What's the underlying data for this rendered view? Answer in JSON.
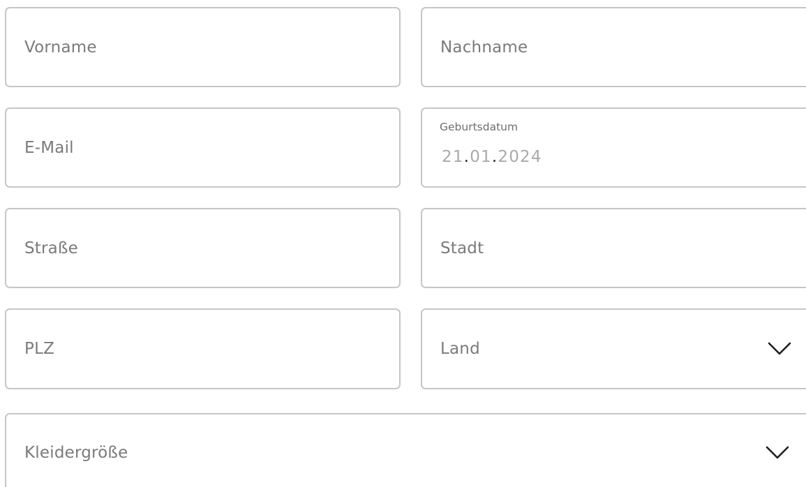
{
  "form": {
    "first_name": {
      "placeholder": "Vorname"
    },
    "last_name": {
      "placeholder": "Nachname"
    },
    "email": {
      "placeholder": "E-Mail"
    },
    "birth_date": {
      "label": "Geburtsdatum",
      "day": "21",
      "month": "01",
      "year": "2024",
      "separator": "."
    },
    "street": {
      "placeholder": "Straße"
    },
    "city": {
      "placeholder": "Stadt"
    },
    "zip": {
      "placeholder": "PLZ"
    },
    "country": {
      "placeholder": "Land",
      "icon": "chevron-down-icon"
    },
    "clothing_size": {
      "placeholder": "Kleidergröße",
      "icon": "chevron-down-icon"
    }
  },
  "colors": {
    "border": "#c6c6c6",
    "placeholder": "#7a7a7a",
    "label": "#6e6e6e",
    "date_digits": "#a9a9a9",
    "date_separator": "#1e1e1e"
  }
}
